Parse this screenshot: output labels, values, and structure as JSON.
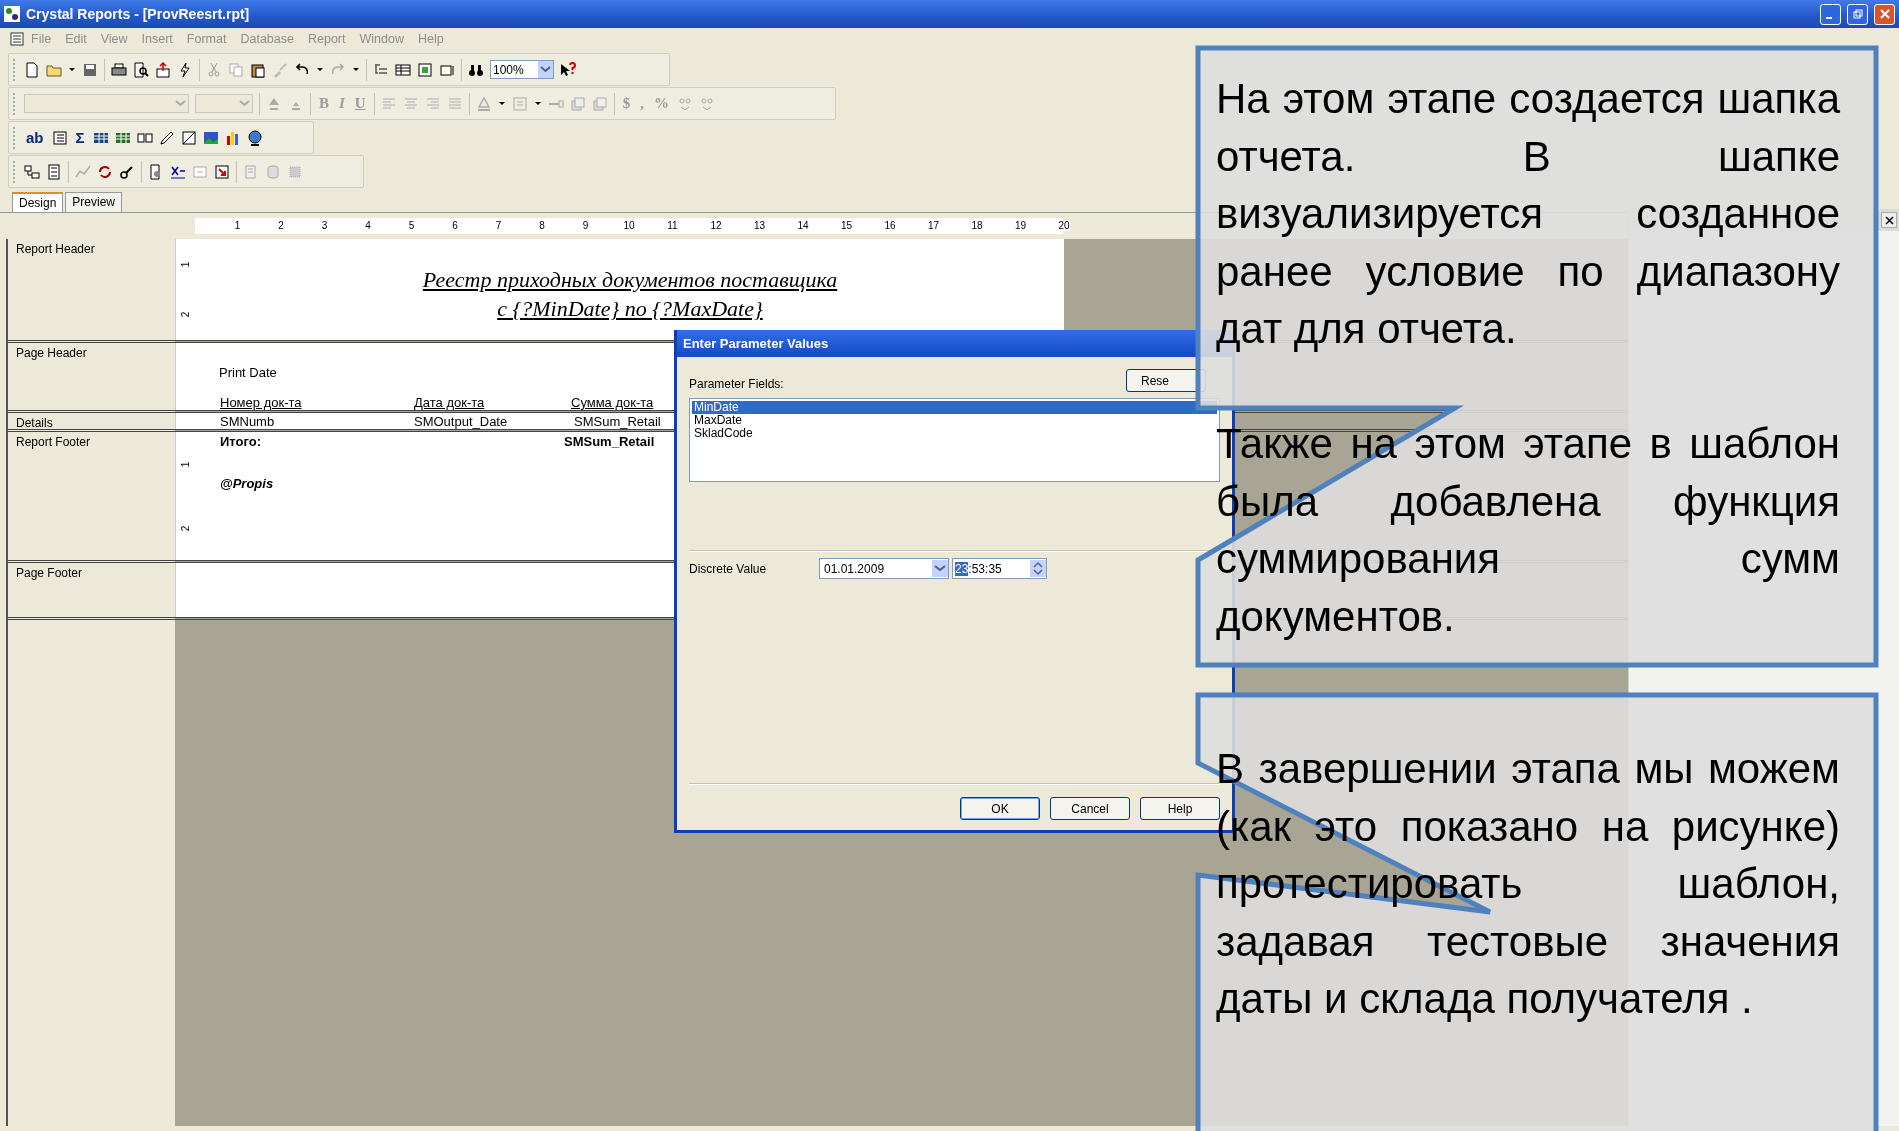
{
  "window": {
    "title": "Crystal Reports - [ProvReesrt.rpt]"
  },
  "menu": [
    {
      "label": "File",
      "disabled": true
    },
    {
      "label": "Edit",
      "disabled": true
    },
    {
      "label": "View",
      "disabled": true
    },
    {
      "label": "Insert",
      "disabled": true
    },
    {
      "label": "Format",
      "disabled": true
    },
    {
      "label": "Database",
      "disabled": true
    },
    {
      "label": "Report",
      "disabled": true
    },
    {
      "label": "Window",
      "disabled": true
    },
    {
      "label": "Help",
      "disabled": true
    }
  ],
  "toolbars": {
    "zoom": "100%",
    "text_buttons": [
      "B",
      "I",
      "U",
      "$",
      ",",
      "%",
      "ab",
      "Σ"
    ]
  },
  "tabs": [
    {
      "label": "Design",
      "selected": true
    },
    {
      "label": "Preview",
      "selected": false
    }
  ],
  "ruler": [
    "1",
    "2",
    "3",
    "4",
    "5",
    "6",
    "7",
    "8",
    "9",
    "10",
    "11",
    "12",
    "13",
    "14",
    "15",
    "16",
    "17",
    "18",
    "19",
    "20"
  ],
  "sections": [
    {
      "name": "Report Header",
      "kind": "report_header",
      "ruler_marks": [
        "1",
        "2"
      ],
      "fields": [
        {
          "text": "Реестр приходных документов поставщика",
          "kind": "title"
        },
        {
          "text": "с {?MinDate} по {?MaxDate}",
          "kind": "title"
        }
      ]
    },
    {
      "name": "Page Header",
      "kind": "page_header",
      "fields": [
        {
          "text": "Print Date",
          "kind": "label"
        },
        {
          "text": "Номер док-та",
          "kind": "header"
        },
        {
          "text": "Дата док-та",
          "kind": "header"
        },
        {
          "text": "Сумма док-та",
          "kind": "header"
        }
      ]
    },
    {
      "name": "Details",
      "kind": "details",
      "fields": [
        {
          "text": "SMNumb",
          "kind": "field"
        },
        {
          "text": "SMOutput_Date",
          "kind": "field"
        },
        {
          "text": "SMSum_Retail",
          "kind": "field"
        }
      ]
    },
    {
      "name": "Report Footer",
      "kind": "report_footer",
      "ruler_marks": [
        "1",
        "2"
      ],
      "fields": [
        {
          "text": "Итого:",
          "kind": "total"
        },
        {
          "text": "SMSum_Retail",
          "kind": "total"
        },
        {
          "text": "@Propis",
          "kind": "formula"
        }
      ]
    },
    {
      "name": "Page Footer",
      "kind": "page_footer"
    }
  ],
  "dialog": {
    "title": "Enter Parameter Values",
    "fields_label": "Parameter Fields:",
    "reset": "Rese",
    "parameters": [
      {
        "label": "MinDate",
        "selected": true
      },
      {
        "label": "MaxDate",
        "selected": false
      },
      {
        "label": "SkladCode",
        "selected": false
      }
    ],
    "value_label": "Discrete Value",
    "date": "01.01.2009",
    "time_selected": "23",
    "time_rest": ":53:35",
    "buttons": [
      "OK",
      "Cancel",
      "Help"
    ]
  },
  "callouts": [
    {
      "paragraphs": [
        "На этом этапе создается шапка отчета. В шапке визуализируется созданное ранее условие по диапазону дат для отчета.",
        "Также на этом этапе в шаблон была добавлена функция суммирования сумм документов."
      ]
    },
    {
      "paragraphs": [
        "В завершении этапа мы можем (как это показано на рисунке) протестировать шаблон, задавая тестовые значения даты и склада получателя ."
      ]
    }
  ]
}
